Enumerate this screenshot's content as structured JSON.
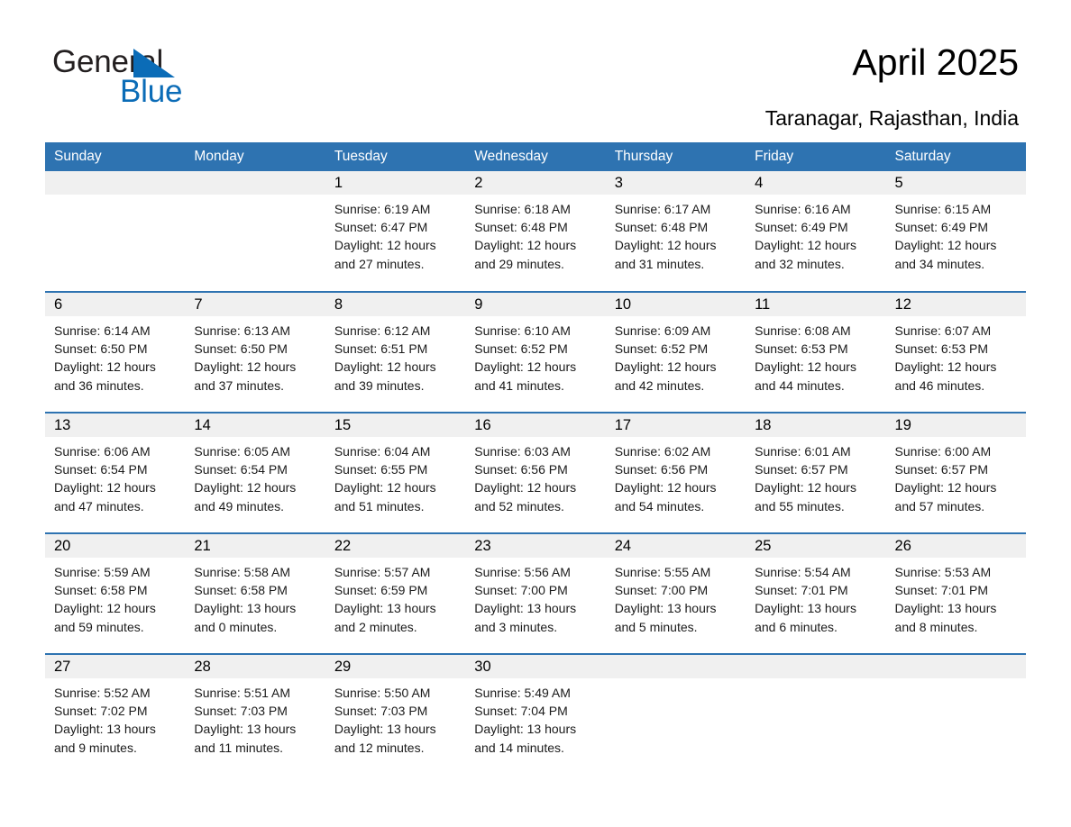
{
  "logo": {
    "word_black": "General",
    "word_blue": "Blue",
    "triangle_color": "#0b6cb7"
  },
  "header": {
    "title": "April 2025",
    "subtitle": "Taranagar, Rajasthan, India"
  },
  "colors": {
    "header_blue": "#2e73b1",
    "daynum_band": "#f0f0f0",
    "logo_blue": "#0b6cb7"
  },
  "weekday_headers": [
    "Sunday",
    "Monday",
    "Tuesday",
    "Wednesday",
    "Thursday",
    "Friday",
    "Saturday"
  ],
  "weeks": [
    [
      {
        "day": "",
        "blank": true,
        "sunrise": "",
        "sunset": "",
        "daylight_a": "",
        "daylight_b": ""
      },
      {
        "day": "",
        "blank": true,
        "sunrise": "",
        "sunset": "",
        "daylight_a": "",
        "daylight_b": ""
      },
      {
        "day": "1",
        "sunrise": "Sunrise: 6:19 AM",
        "sunset": "Sunset: 6:47 PM",
        "daylight_a": "Daylight: 12 hours",
        "daylight_b": "and 27 minutes."
      },
      {
        "day": "2",
        "sunrise": "Sunrise: 6:18 AM",
        "sunset": "Sunset: 6:48 PM",
        "daylight_a": "Daylight: 12 hours",
        "daylight_b": "and 29 minutes."
      },
      {
        "day": "3",
        "sunrise": "Sunrise: 6:17 AM",
        "sunset": "Sunset: 6:48 PM",
        "daylight_a": "Daylight: 12 hours",
        "daylight_b": "and 31 minutes."
      },
      {
        "day": "4",
        "sunrise": "Sunrise: 6:16 AM",
        "sunset": "Sunset: 6:49 PM",
        "daylight_a": "Daylight: 12 hours",
        "daylight_b": "and 32 minutes."
      },
      {
        "day": "5",
        "sunrise": "Sunrise: 6:15 AM",
        "sunset": "Sunset: 6:49 PM",
        "daylight_a": "Daylight: 12 hours",
        "daylight_b": "and 34 minutes."
      }
    ],
    [
      {
        "day": "6",
        "sunrise": "Sunrise: 6:14 AM",
        "sunset": "Sunset: 6:50 PM",
        "daylight_a": "Daylight: 12 hours",
        "daylight_b": "and 36 minutes."
      },
      {
        "day": "7",
        "sunrise": "Sunrise: 6:13 AM",
        "sunset": "Sunset: 6:50 PM",
        "daylight_a": "Daylight: 12 hours",
        "daylight_b": "and 37 minutes."
      },
      {
        "day": "8",
        "sunrise": "Sunrise: 6:12 AM",
        "sunset": "Sunset: 6:51 PM",
        "daylight_a": "Daylight: 12 hours",
        "daylight_b": "and 39 minutes."
      },
      {
        "day": "9",
        "sunrise": "Sunrise: 6:10 AM",
        "sunset": "Sunset: 6:52 PM",
        "daylight_a": "Daylight: 12 hours",
        "daylight_b": "and 41 minutes."
      },
      {
        "day": "10",
        "sunrise": "Sunrise: 6:09 AM",
        "sunset": "Sunset: 6:52 PM",
        "daylight_a": "Daylight: 12 hours",
        "daylight_b": "and 42 minutes."
      },
      {
        "day": "11",
        "sunrise": "Sunrise: 6:08 AM",
        "sunset": "Sunset: 6:53 PM",
        "daylight_a": "Daylight: 12 hours",
        "daylight_b": "and 44 minutes."
      },
      {
        "day": "12",
        "sunrise": "Sunrise: 6:07 AM",
        "sunset": "Sunset: 6:53 PM",
        "daylight_a": "Daylight: 12 hours",
        "daylight_b": "and 46 minutes."
      }
    ],
    [
      {
        "day": "13",
        "sunrise": "Sunrise: 6:06 AM",
        "sunset": "Sunset: 6:54 PM",
        "daylight_a": "Daylight: 12 hours",
        "daylight_b": "and 47 minutes."
      },
      {
        "day": "14",
        "sunrise": "Sunrise: 6:05 AM",
        "sunset": "Sunset: 6:54 PM",
        "daylight_a": "Daylight: 12 hours",
        "daylight_b": "and 49 minutes."
      },
      {
        "day": "15",
        "sunrise": "Sunrise: 6:04 AM",
        "sunset": "Sunset: 6:55 PM",
        "daylight_a": "Daylight: 12 hours",
        "daylight_b": "and 51 minutes."
      },
      {
        "day": "16",
        "sunrise": "Sunrise: 6:03 AM",
        "sunset": "Sunset: 6:56 PM",
        "daylight_a": "Daylight: 12 hours",
        "daylight_b": "and 52 minutes."
      },
      {
        "day": "17",
        "sunrise": "Sunrise: 6:02 AM",
        "sunset": "Sunset: 6:56 PM",
        "daylight_a": "Daylight: 12 hours",
        "daylight_b": "and 54 minutes."
      },
      {
        "day": "18",
        "sunrise": "Sunrise: 6:01 AM",
        "sunset": "Sunset: 6:57 PM",
        "daylight_a": "Daylight: 12 hours",
        "daylight_b": "and 55 minutes."
      },
      {
        "day": "19",
        "sunrise": "Sunrise: 6:00 AM",
        "sunset": "Sunset: 6:57 PM",
        "daylight_a": "Daylight: 12 hours",
        "daylight_b": "and 57 minutes."
      }
    ],
    [
      {
        "day": "20",
        "sunrise": "Sunrise: 5:59 AM",
        "sunset": "Sunset: 6:58 PM",
        "daylight_a": "Daylight: 12 hours",
        "daylight_b": "and 59 minutes."
      },
      {
        "day": "21",
        "sunrise": "Sunrise: 5:58 AM",
        "sunset": "Sunset: 6:58 PM",
        "daylight_a": "Daylight: 13 hours",
        "daylight_b": "and 0 minutes."
      },
      {
        "day": "22",
        "sunrise": "Sunrise: 5:57 AM",
        "sunset": "Sunset: 6:59 PM",
        "daylight_a": "Daylight: 13 hours",
        "daylight_b": "and 2 minutes."
      },
      {
        "day": "23",
        "sunrise": "Sunrise: 5:56 AM",
        "sunset": "Sunset: 7:00 PM",
        "daylight_a": "Daylight: 13 hours",
        "daylight_b": "and 3 minutes."
      },
      {
        "day": "24",
        "sunrise": "Sunrise: 5:55 AM",
        "sunset": "Sunset: 7:00 PM",
        "daylight_a": "Daylight: 13 hours",
        "daylight_b": "and 5 minutes."
      },
      {
        "day": "25",
        "sunrise": "Sunrise: 5:54 AM",
        "sunset": "Sunset: 7:01 PM",
        "daylight_a": "Daylight: 13 hours",
        "daylight_b": "and 6 minutes."
      },
      {
        "day": "26",
        "sunrise": "Sunrise: 5:53 AM",
        "sunset": "Sunset: 7:01 PM",
        "daylight_a": "Daylight: 13 hours",
        "daylight_b": "and 8 minutes."
      }
    ],
    [
      {
        "day": "27",
        "sunrise": "Sunrise: 5:52 AM",
        "sunset": "Sunset: 7:02 PM",
        "daylight_a": "Daylight: 13 hours",
        "daylight_b": "and 9 minutes."
      },
      {
        "day": "28",
        "sunrise": "Sunrise: 5:51 AM",
        "sunset": "Sunset: 7:03 PM",
        "daylight_a": "Daylight: 13 hours",
        "daylight_b": "and 11 minutes."
      },
      {
        "day": "29",
        "sunrise": "Sunrise: 5:50 AM",
        "sunset": "Sunset: 7:03 PM",
        "daylight_a": "Daylight: 13 hours",
        "daylight_b": "and 12 minutes."
      },
      {
        "day": "30",
        "sunrise": "Sunrise: 5:49 AM",
        "sunset": "Sunset: 7:04 PM",
        "daylight_a": "Daylight: 13 hours",
        "daylight_b": "and 14 minutes."
      },
      {
        "day": "",
        "blank": true,
        "sunrise": "",
        "sunset": "",
        "daylight_a": "",
        "daylight_b": ""
      },
      {
        "day": "",
        "blank": true,
        "sunrise": "",
        "sunset": "",
        "daylight_a": "",
        "daylight_b": ""
      },
      {
        "day": "",
        "blank": true,
        "sunrise": "",
        "sunset": "",
        "daylight_a": "",
        "daylight_b": ""
      }
    ]
  ]
}
